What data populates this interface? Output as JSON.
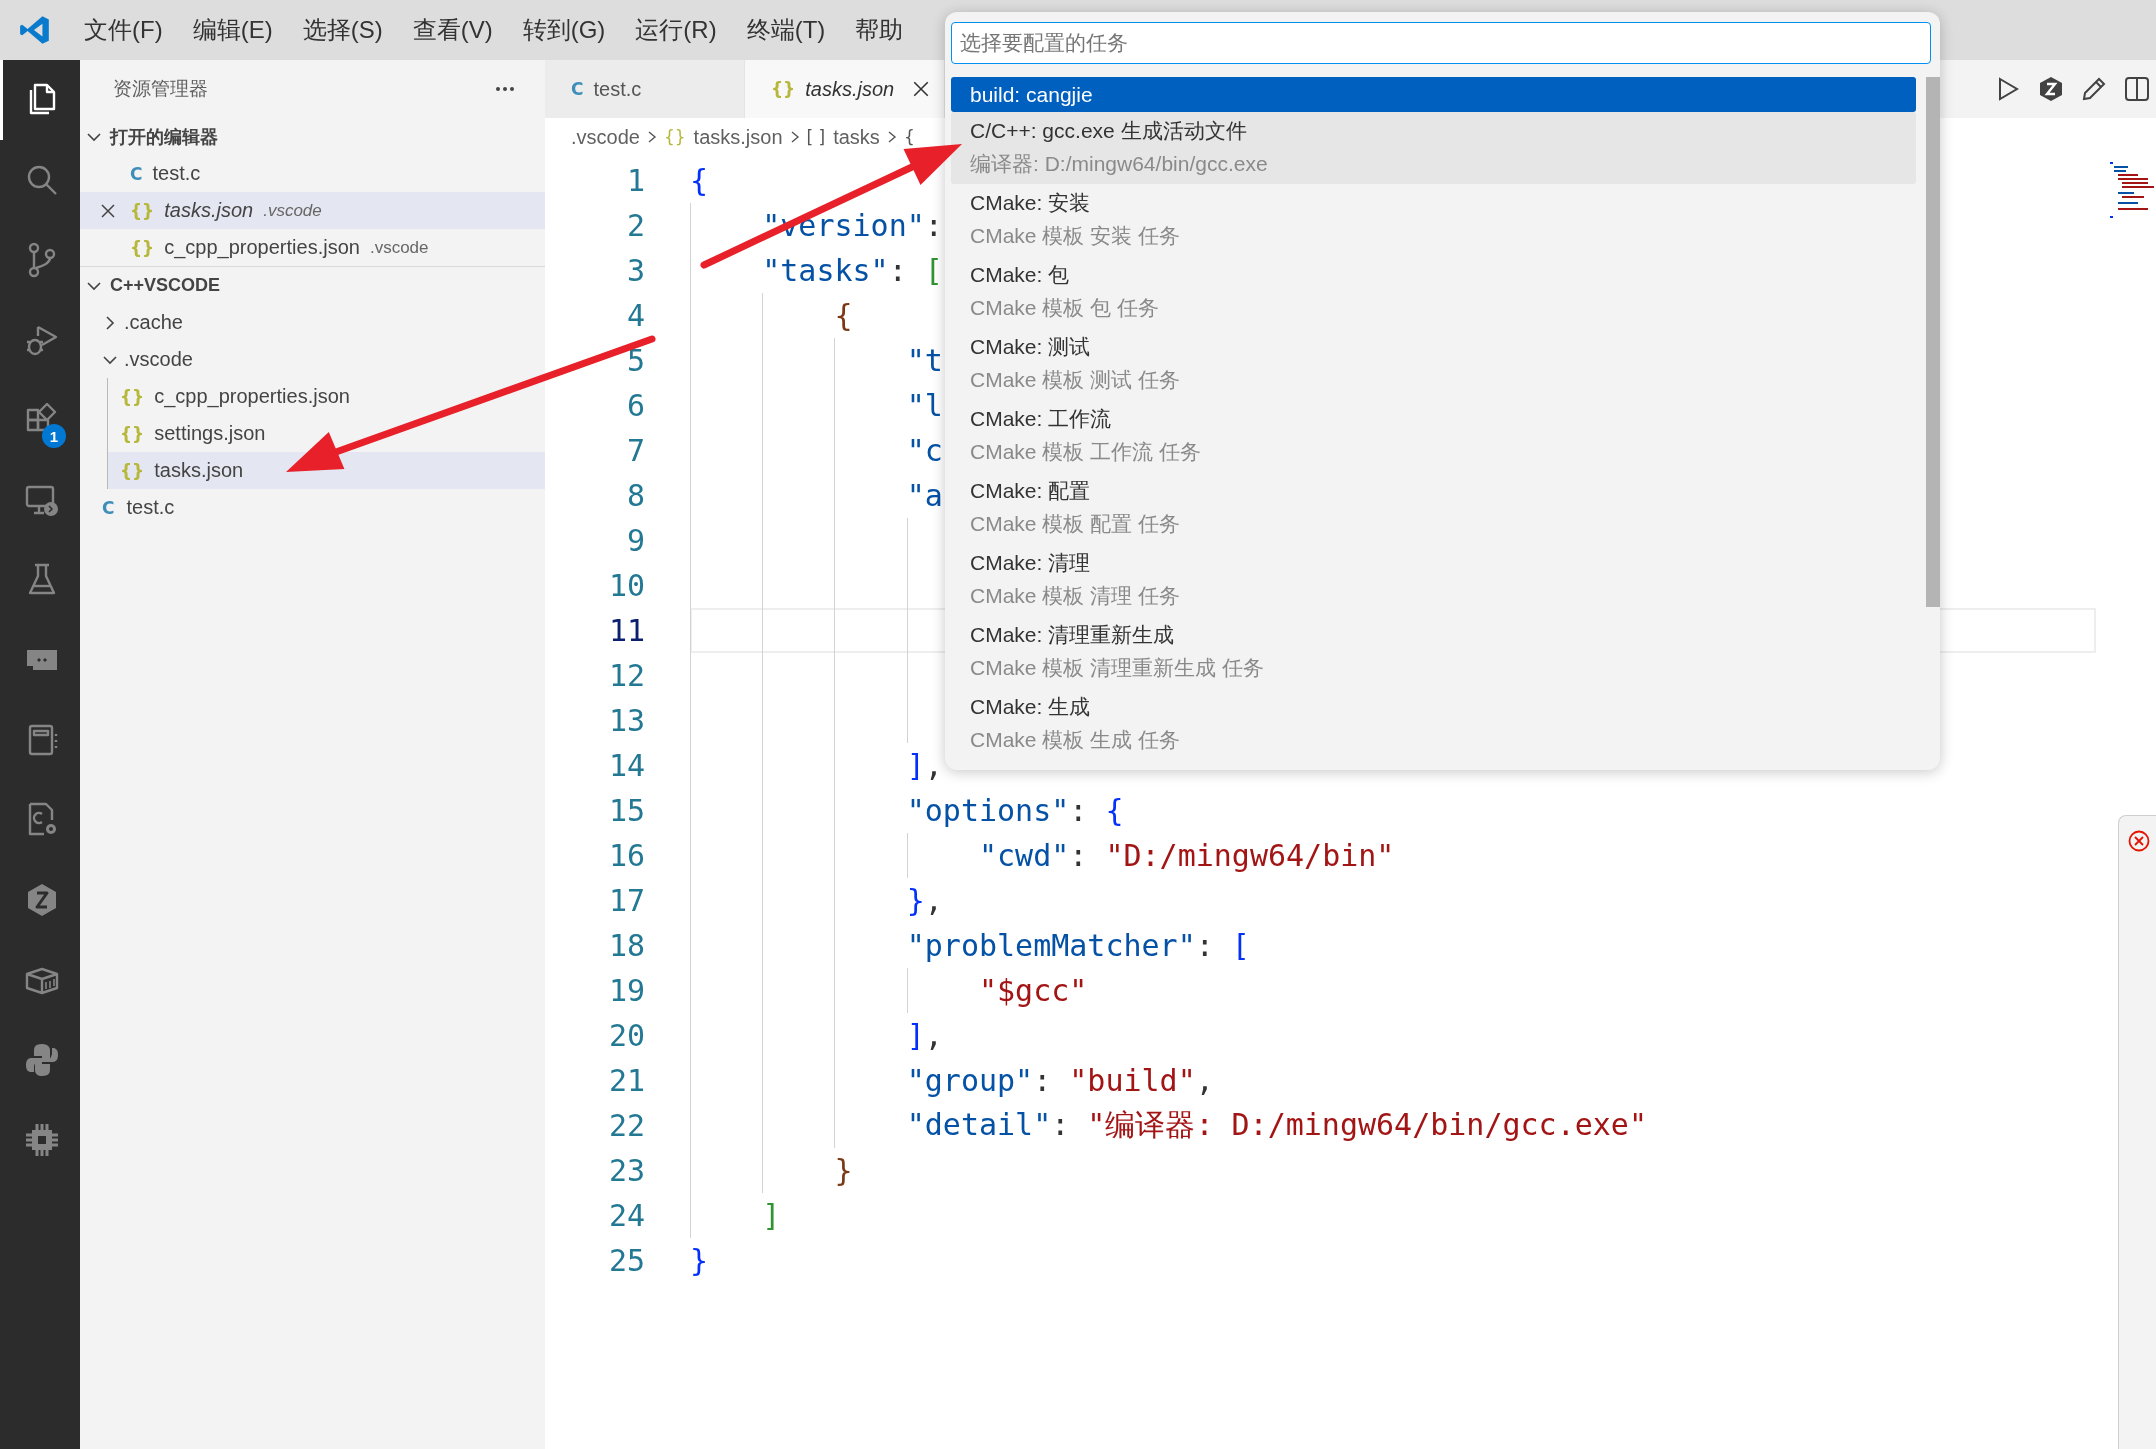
{
  "menu": [
    "文件(F)",
    "编辑(E)",
    "选择(S)",
    "查看(V)",
    "转到(G)",
    "运行(R)",
    "终端(T)",
    "帮助"
  ],
  "activity_bar": [
    {
      "selected": true
    },
    {
      "selected": false
    },
    {
      "selected": false
    },
    {
      "selected": false
    },
    {
      "selected": false,
      "badge": "1"
    },
    {
      "selected": false
    },
    {
      "selected": false
    },
    {
      "selected": false
    },
    {
      "selected": false
    },
    {
      "selected": false
    },
    {
      "selected": false
    },
    {
      "selected": false
    },
    {
      "selected": false
    },
    {
      "selected": false
    }
  ],
  "sidebar": {
    "title": "资源管理器",
    "open_editors": {
      "label": "打开的编辑器",
      "expanded": true,
      "items": [
        {
          "icon": "C",
          "kind": "c",
          "name": "test.c",
          "selected": false,
          "preview": false
        },
        {
          "icon": "{}",
          "kind": "json",
          "name": "tasks.json",
          "path": ".vscode",
          "selected": true,
          "preview": true
        },
        {
          "icon": "{}",
          "kind": "json",
          "name": "c_cpp_properties.json",
          "path": ".vscode",
          "selected": false,
          "preview": false
        }
      ]
    },
    "folder": {
      "label": "C++VSCODE",
      "expanded": true,
      "items": [
        {
          "kind": "folder",
          "name": ".cache",
          "expanded": false,
          "selected": false
        },
        {
          "kind": "folder",
          "name": ".vscode",
          "expanded": true,
          "selected": false,
          "children": [
            {
              "kind": "json",
              "icon": "{}",
              "name": "c_cpp_properties.json",
              "selected": false
            },
            {
              "kind": "json",
              "icon": "{}",
              "name": "settings.json",
              "selected": false
            },
            {
              "kind": "json",
              "icon": "{}",
              "name": "tasks.json",
              "selected": true
            }
          ]
        },
        {
          "kind": "c",
          "icon": "C",
          "name": "test.c",
          "selected": false
        }
      ]
    }
  },
  "tabs": [
    {
      "icon": "C",
      "kind": "c",
      "label": "test.c",
      "selected": false,
      "preview": false
    },
    {
      "icon": "{}",
      "kind": "json",
      "label": "tasks.json",
      "selected": true,
      "preview": true
    }
  ],
  "breadcrumb": [
    {
      "label": ".vscode"
    },
    {
      "icon": "{}",
      "kind": "json",
      "label": "tasks.json"
    },
    {
      "icon": "[ ]",
      "kind": "symbol",
      "label": "tasks"
    },
    {
      "icon": "{",
      "kind": "symbol"
    }
  ],
  "editor": {
    "lines": [
      {
        "n": "1",
        "current": false,
        "tokens": [
          {
            "kind": "b1",
            "t": "{"
          }
        ]
      },
      {
        "n": "2",
        "current": false,
        "tokens": [
          {
            "kind": "key",
            "t": "\"version\""
          },
          {
            "kind": "p",
            "t": ":"
          }
        ]
      },
      {
        "n": "3",
        "current": false,
        "tokens": [
          {
            "kind": "key",
            "t": "\"tasks\""
          },
          {
            "kind": "p",
            "t": ": "
          },
          {
            "kind": "b2",
            "t": "["
          }
        ]
      },
      {
        "n": "4",
        "current": false,
        "tokens": [
          {
            "kind": "b3",
            "t": "{"
          }
        ]
      },
      {
        "n": "5",
        "current": false,
        "tokens": [
          {
            "kind": "key",
            "t": "\"t"
          }
        ]
      },
      {
        "n": "6",
        "current": false,
        "tokens": [
          {
            "kind": "key",
            "t": "\"l"
          }
        ]
      },
      {
        "n": "7",
        "current": false,
        "tokens": [
          {
            "kind": "key",
            "t": "\"c"
          }
        ]
      },
      {
        "n": "8",
        "current": false,
        "tokens": [
          {
            "kind": "key",
            "t": "\"a"
          }
        ]
      },
      {
        "n": "9",
        "current": false
      },
      {
        "n": "10",
        "current": false
      },
      {
        "n": "11",
        "current": true
      },
      {
        "n": "12",
        "current": false
      },
      {
        "n": "13",
        "current": false
      },
      {
        "n": "14",
        "current": false,
        "tokens": [
          {
            "kind": "b1",
            "t": "]"
          },
          {
            "kind": "p",
            "t": ","
          }
        ]
      },
      {
        "n": "15",
        "current": false,
        "tokens": [
          {
            "kind": "key",
            "t": "\"options\""
          },
          {
            "kind": "p",
            "t": ": "
          },
          {
            "kind": "b1",
            "t": "{"
          }
        ]
      },
      {
        "n": "16",
        "current": false,
        "tokens": [
          {
            "kind": "key",
            "t": "\"cwd\""
          },
          {
            "kind": "p",
            "t": ": "
          },
          {
            "kind": "str",
            "t": "\"D:/mingw64/bin\""
          }
        ]
      },
      {
        "n": "17",
        "current": false,
        "tokens": [
          {
            "kind": "b1",
            "t": "}"
          },
          {
            "kind": "p",
            "t": ","
          }
        ]
      },
      {
        "n": "18",
        "current": false,
        "tokens": [
          {
            "kind": "key",
            "t": "\"problemMatcher\""
          },
          {
            "kind": "p",
            "t": ": "
          },
          {
            "kind": "b1",
            "t": "["
          }
        ]
      },
      {
        "n": "19",
        "current": false,
        "tokens": [
          {
            "kind": "str",
            "t": "\"$gcc\""
          }
        ]
      },
      {
        "n": "20",
        "current": false,
        "tokens": [
          {
            "kind": "b1",
            "t": "]"
          },
          {
            "kind": "p",
            "t": ","
          }
        ]
      },
      {
        "n": "21",
        "current": false,
        "tokens": [
          {
            "kind": "key",
            "t": "\"group\""
          },
          {
            "kind": "p",
            "t": ": "
          },
          {
            "kind": "str",
            "t": "\"build\""
          },
          {
            "kind": "p",
            "t": ","
          }
        ]
      },
      {
        "n": "22",
        "current": false,
        "tokens": [
          {
            "kind": "key",
            "t": "\"detail\""
          },
          {
            "kind": "p",
            "t": ": "
          },
          {
            "kind": "str",
            "t": "\"编译器: D:/mingw64/bin/gcc.exe\""
          }
        ]
      },
      {
        "n": "23",
        "current": false,
        "tokens": [
          {
            "kind": "b3",
            "t": "}"
          }
        ]
      },
      {
        "n": "24",
        "current": false,
        "tokens": [
          {
            "kind": "b2",
            "t": "]"
          }
        ]
      },
      {
        "n": "25",
        "current": false,
        "tokens": [
          {
            "kind": "b1",
            "t": "}"
          }
        ]
      }
    ]
  },
  "quick_pick": {
    "placeholder": "选择要配置的任务",
    "items": [
      {
        "label": "build: cangjie",
        "selected": true,
        "hovered": false
      },
      {
        "label": "C/C++: gcc.exe 生成活动文件",
        "detail": "编译器: D:/mingw64/bin/gcc.exe",
        "selected": false,
        "hovered": true
      },
      {
        "label": "CMake: 安装",
        "detail": "CMake 模板 安装 任务",
        "selected": false,
        "hovered": false
      },
      {
        "label": "CMake: 包",
        "detail": "CMake 模板 包 任务",
        "selected": false,
        "hovered": false
      },
      {
        "label": "CMake: 测试",
        "detail": "CMake 模板 测试 任务",
        "selected": false,
        "hovered": false
      },
      {
        "label": "CMake: 工作流",
        "detail": "CMake 模板 工作流 任务",
        "selected": false,
        "hovered": false
      },
      {
        "label": "CMake: 配置",
        "detail": "CMake 模板 配置 任务",
        "selected": false,
        "hovered": false
      },
      {
        "label": "CMake: 清理",
        "detail": "CMake 模板 清理 任务",
        "selected": false,
        "hovered": false
      },
      {
        "label": "CMake: 清理重新生成",
        "detail": "CMake 模板 清理重新生成 任务",
        "selected": false,
        "hovered": false
      },
      {
        "label": "CMake: 生成",
        "detail": "CMake 模板 生成 任务",
        "selected": false,
        "hovered": false
      }
    ]
  }
}
